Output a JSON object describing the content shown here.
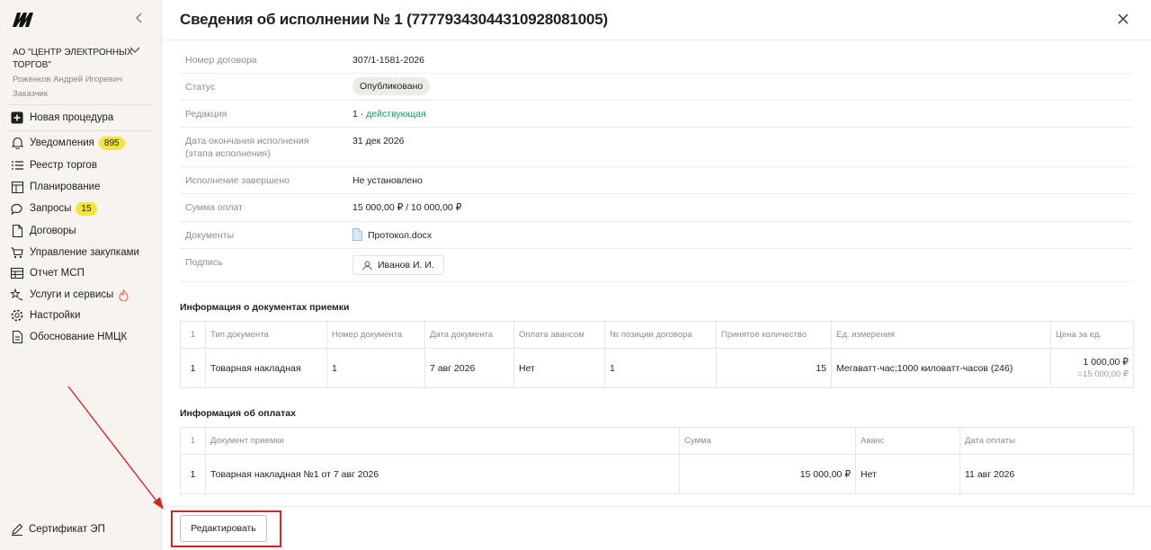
{
  "sidebar": {
    "org": "АО \"ЦЕНТР ЭЛЕКТРОННЫХ ТОРГОВ\"",
    "user_name": "Роженков Андрей Игоревич",
    "user_role": "Заказчик",
    "new_procedure": "Новая процедура",
    "items": [
      {
        "label": "Уведомления",
        "badge": "895",
        "icon": "bell-icon"
      },
      {
        "label": "Реестр торгов",
        "icon": "list-icon"
      },
      {
        "label": "Планирование",
        "icon": "layout-icon"
      },
      {
        "label": "Запросы",
        "badge": "15",
        "icon": "chat-icon"
      },
      {
        "label": "Договоры",
        "icon": "document-icon"
      },
      {
        "label": "Управление закупками",
        "icon": "cart-icon"
      },
      {
        "label": "Отчет МСП",
        "icon": "table-icon"
      },
      {
        "label": "Услуги и сервисы",
        "icon": "star-icon"
      },
      {
        "label": "Настройки",
        "icon": "gear-icon"
      },
      {
        "label": "Обоснование НМЦК",
        "icon": "calc-document-icon"
      }
    ],
    "certificate": "Сертификат ЭП"
  },
  "header": {
    "title": "Сведения об исполнении № 1 (77779343044310928081005)"
  },
  "info": {
    "contract_label": "Номер договора",
    "contract_value": "307/1-1581-2026",
    "status_label": "Статус",
    "status_value": "Опубликовано",
    "edition_label": "Редакция",
    "edition_number": "1 · ",
    "edition_link": "действующая",
    "deadline_label_1": "Дата окончания исполнения",
    "deadline_label_2": "(этапа исполнения)",
    "deadline_value": "31 дек 2026",
    "finished_label": "Исполнение завершено",
    "finished_value": "Не установлено",
    "payments_label": "Сумма оплат",
    "payments_value": "15 000,00 ₽ / 10 000,00 ₽",
    "documents_label": "Документы",
    "documents_value": "Протокол.docx",
    "signature_label": "Подпись",
    "signature_value": "Иванов И. И."
  },
  "acceptance": {
    "title": "Информация о документах приемки",
    "headers": [
      "1",
      "Тип документа",
      "Номер документа",
      "Дата документа",
      "Оплата авансом",
      "№ позиции договора",
      "Принятое количество",
      "Ед. измерения",
      "Цена за ед."
    ],
    "row": {
      "n": "1",
      "type": "Товарная накладная",
      "number": "1",
      "date": "7 авг 2026",
      "advance": "Нет",
      "position": "1",
      "quantity": "15",
      "unit": "Мегаватт-час;1000 киловатт-часов (246)",
      "price": "1 000,00 ₽",
      "price_total": "=15 000,00 ₽"
    }
  },
  "payments": {
    "title": "Информация об оплатах",
    "headers": [
      "1",
      "Документ приемки",
      "Сумма",
      "Аванс",
      "Дата оплаты"
    ],
    "row": {
      "n": "1",
      "document": "Товарная накладная №1 от 7 авг 2026",
      "amount": "15 000,00 ₽",
      "advance": "Нет",
      "date": "11 авг 2026"
    }
  },
  "footer": {
    "edit_label": "Редактировать"
  },
  "colors": {
    "accent_green": "#1a9a5c",
    "badge_yellow": "#f5e342",
    "annotation_red": "#d32727",
    "sidebar_bg": "#f7f3ef"
  }
}
